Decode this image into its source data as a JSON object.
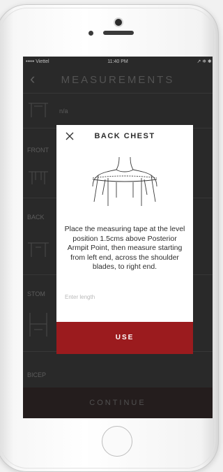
{
  "status_bar": {
    "carrier": "••••• Viettel",
    "time": "11:40 PM",
    "right": "↗ ⛯ ✱ 2 "
  },
  "nav": {
    "back_icon": "chevron-left-icon",
    "title": "MEASUREMENTS"
  },
  "list": {
    "first_value": "n/a",
    "labels": [
      "FRONT",
      "BACK",
      "STOM",
      "BICEP"
    ]
  },
  "continue_label": "CONTINUE",
  "modal": {
    "close_icon": "close-icon",
    "title": "BACK CHEST",
    "instruction": "Place the measuring tape at the level position 1.5cms above Posterior Armpit Point, then measure starting from left end, across the shoulder blades, to right end.",
    "input_placeholder": "Enter length",
    "use_label": "USE"
  },
  "colors": {
    "accent": "#9b1b1e",
    "screen_bg": "#2f2f2f",
    "modal_bg": "#ffffff"
  }
}
